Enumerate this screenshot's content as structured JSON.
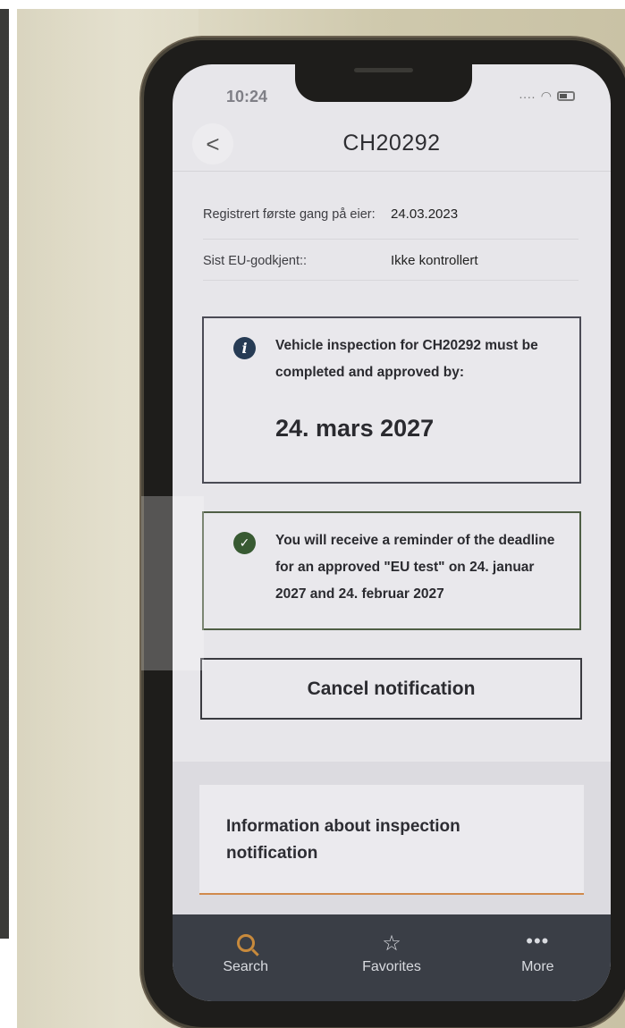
{
  "status_bar": {
    "time": "10:24"
  },
  "header": {
    "back_glyph": "<",
    "title": "CH20292"
  },
  "vehicle_info": [
    {
      "label": "Registrert første gang på eier:",
      "value": "24.03.2023"
    },
    {
      "label": "Sist EU-godkjent::",
      "value": "Ikke kontrollert"
    }
  ],
  "inspection_card": {
    "icon": "info-icon",
    "message": "Vehicle inspection for CH20292 must be completed and approved by:",
    "deadline": "24. mars 2027"
  },
  "reminder_card": {
    "icon": "check-icon",
    "message": "You will receive a reminder of the deadline for an approved \"EU test\" on 24. januar 2027 and 24. februar 2027"
  },
  "cancel_button": {
    "label": "Cancel notification"
  },
  "info_link": {
    "label": "Information about inspection notification"
  },
  "tab_bar": {
    "tabs": [
      {
        "icon": "search-icon",
        "label": "Search",
        "active": true
      },
      {
        "icon": "star-icon",
        "label": "Favorites",
        "active": false
      },
      {
        "icon": "more-icon",
        "label": "More",
        "active": false
      }
    ]
  },
  "colors": {
    "accent": "#c88a3c",
    "info_icon": "#263b54",
    "success_icon": "#385a32",
    "tab_bar": "#3a3e46"
  }
}
